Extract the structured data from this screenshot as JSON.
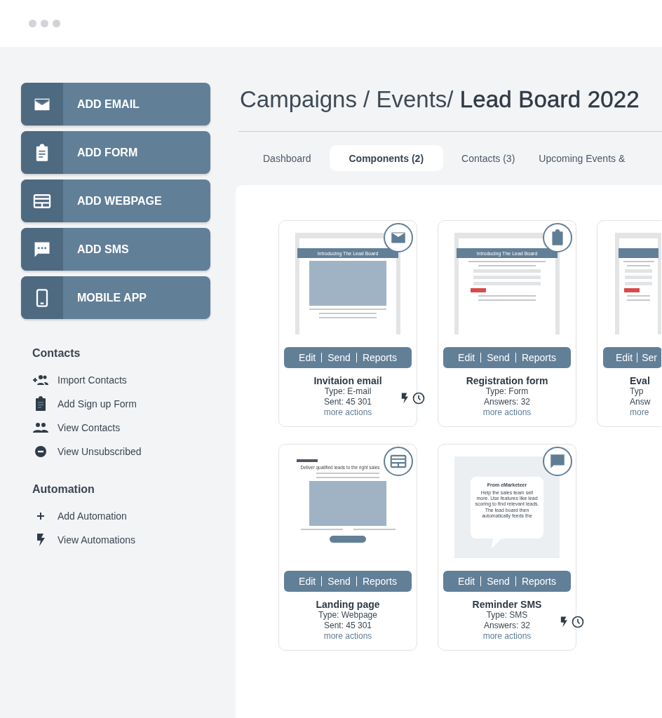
{
  "sidebar": {
    "actions": [
      {
        "label": "ADD EMAIL",
        "kind": "email"
      },
      {
        "label": "ADD FORM",
        "kind": "form"
      },
      {
        "label": "ADD WEBPAGE",
        "kind": "webpage"
      },
      {
        "label": "ADD SMS",
        "kind": "sms"
      },
      {
        "label": "MOBILE APP",
        "kind": "mobile"
      }
    ],
    "sections": [
      {
        "title": "Contacts",
        "items": [
          {
            "label": "Import Contacts",
            "kind": "add-people"
          },
          {
            "label": "Add Sign up Form",
            "kind": "form"
          },
          {
            "label": "View Contacts",
            "kind": "people"
          },
          {
            "label": "View Unsubscribed",
            "kind": "minus"
          }
        ]
      },
      {
        "title": "Automation",
        "items": [
          {
            "label": "Add Automation",
            "kind": "plus"
          },
          {
            "label": "View Automations",
            "kind": "flash"
          }
        ]
      }
    ]
  },
  "breadcrumb": "Campaigns / Events/ **Lead Board 2022**",
  "tabs": [
    {
      "label": "Dashboard",
      "selected": false
    },
    {
      "label": "Components (2)",
      "selected": true
    },
    {
      "label": "Contacts  (3)",
      "selected": false
    },
    {
      "label": "Upcoming Events &",
      "selected": false
    }
  ],
  "cards": [
    {
      "kind": "full",
      "preview": {
        "kind": "email",
        "header": "Introducing The Lead Board"
      },
      "actions": [
        "Edit",
        "Send",
        "Reports"
      ],
      "title": "Invitaion email",
      "type": "Type: E-mail",
      "stat": "Sent: 45 301",
      "link": "more actions",
      "scheduled": true
    },
    {
      "kind": "full",
      "preview": {
        "kind": "form",
        "header": "Introducing The Lead Board"
      },
      "actions": [
        "Edit",
        "Send",
        "Reports"
      ],
      "title": "Registration form",
      "type": "Type: Form",
      "stat": "Answers: 32",
      "link": "more actions",
      "scheduled": false
    },
    {
      "kind": "cut",
      "preview": {
        "kind": "form"
      },
      "actions": [
        "Edit",
        "Ser"
      ],
      "title": "Eval",
      "type": "Typ",
      "stat": "Answ",
      "link": "more",
      "scheduled": false
    },
    {
      "kind": "full",
      "preview": {
        "kind": "webpage",
        "header": "Deliver qualified leads to the right sales"
      },
      "actions": [
        "Edit",
        "Send",
        "Reports"
      ],
      "title": "Landing page",
      "type": "Type: Webpage",
      "stat": "Sent: 45 301",
      "link": "more actions",
      "scheduled": false
    },
    {
      "kind": "full",
      "preview": {
        "kind": "sms",
        "header": "From eMarketeer",
        "text": "Help the sales team sell more. Use features like lead scoring to find relevant leads. The lead board then automatically feeds the"
      },
      "actions": [
        "Edit",
        "Send",
        "Reports"
      ],
      "title": "Reminder SMS",
      "type": "Type: SMS",
      "stat": "Answers: 32",
      "link": "more actions",
      "scheduled": true
    }
  ]
}
